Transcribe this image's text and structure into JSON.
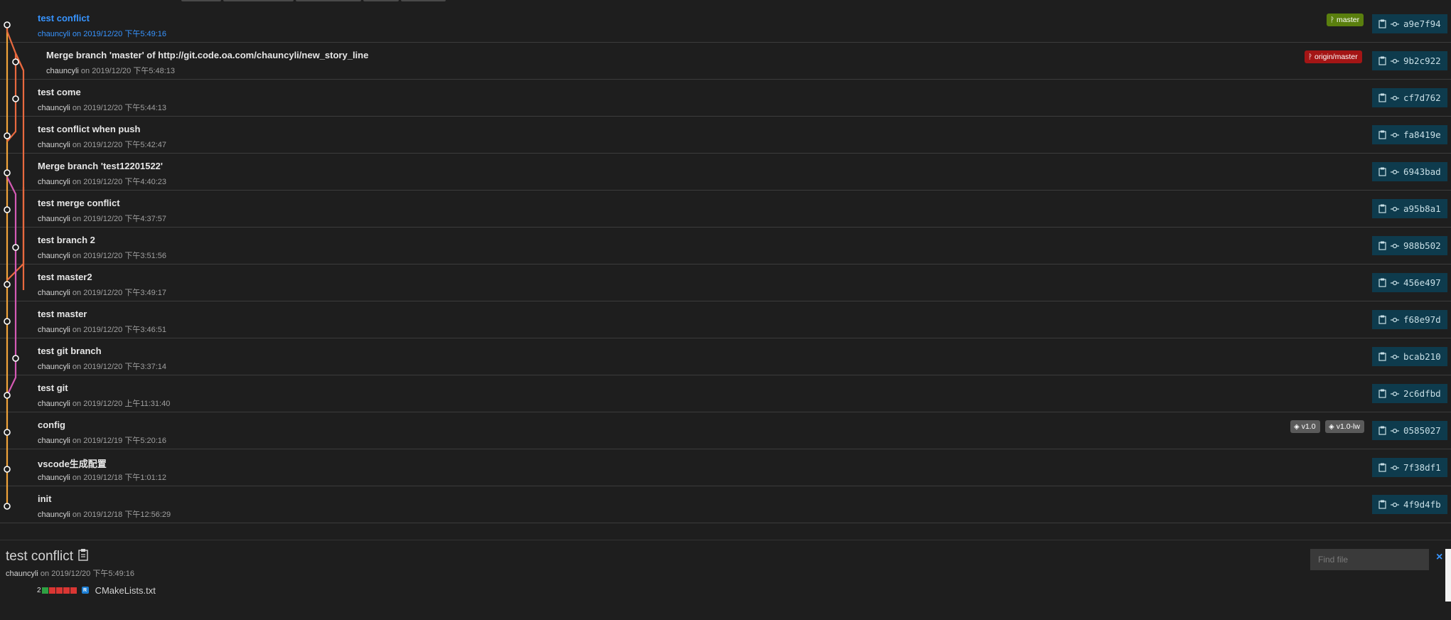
{
  "commits": [
    {
      "message": "test conflict",
      "author": "chauncyli",
      "date": "on 2019/12/20 下午5:49:16",
      "hash": "a9e7f94"
    },
    {
      "message": "Merge branch 'master' of http://git.code.oa.com/chauncyli/new_story_line",
      "author": "chauncyli",
      "date": "on 2019/12/20 下午5:48:13",
      "hash": "9b2c922"
    },
    {
      "message": "test come",
      "author": "chauncyli",
      "date": "on 2019/12/20 下午5:44:13",
      "hash": "cf7d762"
    },
    {
      "message": "test conflict when push",
      "author": "chauncyli",
      "date": "on 2019/12/20 下午5:42:47",
      "hash": "fa8419e"
    },
    {
      "message": "Merge branch 'test12201522'",
      "author": "chauncyli",
      "date": "on 2019/12/20 下午4:40:23",
      "hash": "6943bad"
    },
    {
      "message": "test merge conflict",
      "author": "chauncyli",
      "date": "on 2019/12/20 下午4:37:57",
      "hash": "a95b8a1"
    },
    {
      "message": "test branch 2",
      "author": "chauncyli",
      "date": "on 2019/12/20 下午3:51:56",
      "hash": "988b502"
    },
    {
      "message": "test master2",
      "author": "chauncyli",
      "date": "on 2019/12/20 下午3:49:17",
      "hash": "456e497"
    },
    {
      "message": "test master",
      "author": "chauncyli",
      "date": "on 2019/12/20 下午3:46:51",
      "hash": "f68e97d"
    },
    {
      "message": "test git branch",
      "author": "chauncyli",
      "date": "on 2019/12/20 下午3:37:14",
      "hash": "bcab210"
    },
    {
      "message": "test git",
      "author": "chauncyli",
      "date": "on 2019/12/20 上午11:31:40",
      "hash": "2c6dfbd"
    },
    {
      "message": "config",
      "author": "chauncyli",
      "date": "on 2019/12/19 下午5:20:16",
      "hash": "0585027"
    },
    {
      "message": "vscode生成配置",
      "author": "chauncyli",
      "date": "on 2019/12/18 下午1:01:12",
      "hash": "7f38df1"
    },
    {
      "message": "init",
      "author": "chauncyli",
      "date": "on 2019/12/18 下午12:56:29",
      "hash": "4f9d4fb"
    }
  ],
  "badges": {
    "master": "master",
    "origin_master": "origin/master",
    "tag_v1": "v1.0",
    "tag_v1_lw": "v1.0-lw"
  },
  "details": {
    "title": "test conflict",
    "author": "chauncyli",
    "date": "on 2019/12/20 下午5:49:16",
    "file": {
      "count": "2",
      "status": "R",
      "name": "CMakeLists.txt"
    },
    "find_placeholder": "Find file",
    "close_label": "×"
  },
  "colors": {
    "graph_orange": "#f0a33a",
    "graph_red": "#e8693f",
    "graph_pink": "#d45ab4",
    "hash_bg": "#0e3b4d",
    "selected_text": "#3794ff",
    "master_badge": "#5a7f0e",
    "origin_badge": "#a41515",
    "tag_badge": "#5a5a5a"
  },
  "icons": {
    "hash_copy": "clipboard-icon",
    "hash_commit": "git-commit-icon",
    "branch": "git-branch-icon",
    "tag": "tag-icon"
  }
}
